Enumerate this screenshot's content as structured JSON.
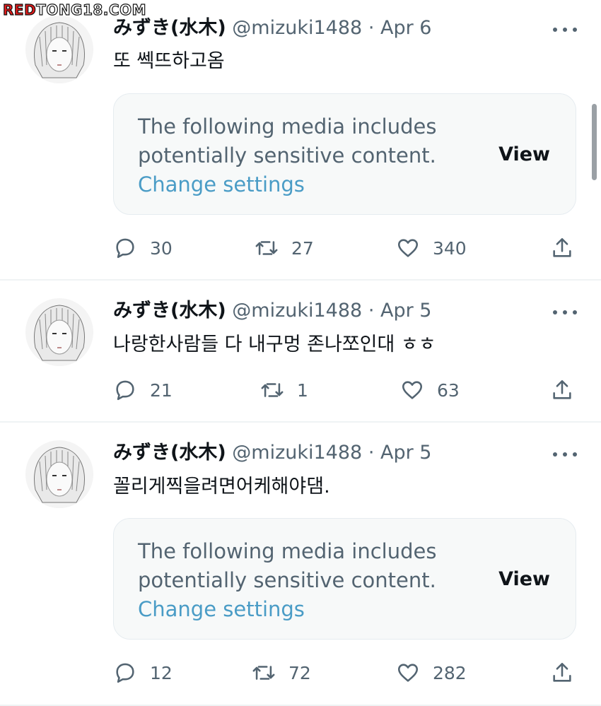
{
  "watermark": {
    "red": "RED",
    "rest": "TONG18.COM"
  },
  "tweets": [
    {
      "name": "みずき(水木)",
      "handle": "@mizuki1488",
      "date": "Apr 6",
      "sep": "·",
      "text": "또 쎅뜨하고옴",
      "media": {
        "line1": "The following media includes",
        "line2": "potentially sensitive content.",
        "link": "Change settings",
        "view": "View"
      },
      "replies": "30",
      "retweets": "27",
      "likes": "340"
    },
    {
      "name": "みずき(水木)",
      "handle": "@mizuki1488",
      "date": "Apr 5",
      "sep": "·",
      "text": "나랑한사람들 다 내구멍 존나쪼인대 ㅎㅎ",
      "replies": "21",
      "retweets": "1",
      "likes": "63"
    },
    {
      "name": "みずき(水木)",
      "handle": "@mizuki1488",
      "date": "Apr 5",
      "sep": "·",
      "text": "꼴리게찍을려면어케해야댐.",
      "media": {
        "line1": "The following media includes",
        "line2": "potentially sensitive content.",
        "link": "Change settings",
        "view": "View"
      },
      "replies": "12",
      "retweets": "72",
      "likes": "282"
    }
  ],
  "icons": {
    "reply": "reply-icon",
    "retweet": "retweet-icon",
    "like": "heart-icon",
    "share": "share-icon",
    "more": "more-icon"
  },
  "colors": {
    "text": "#0f1419",
    "secondary": "#536471",
    "link": "#4a9cc6",
    "media_bg": "#f7f9f9"
  }
}
